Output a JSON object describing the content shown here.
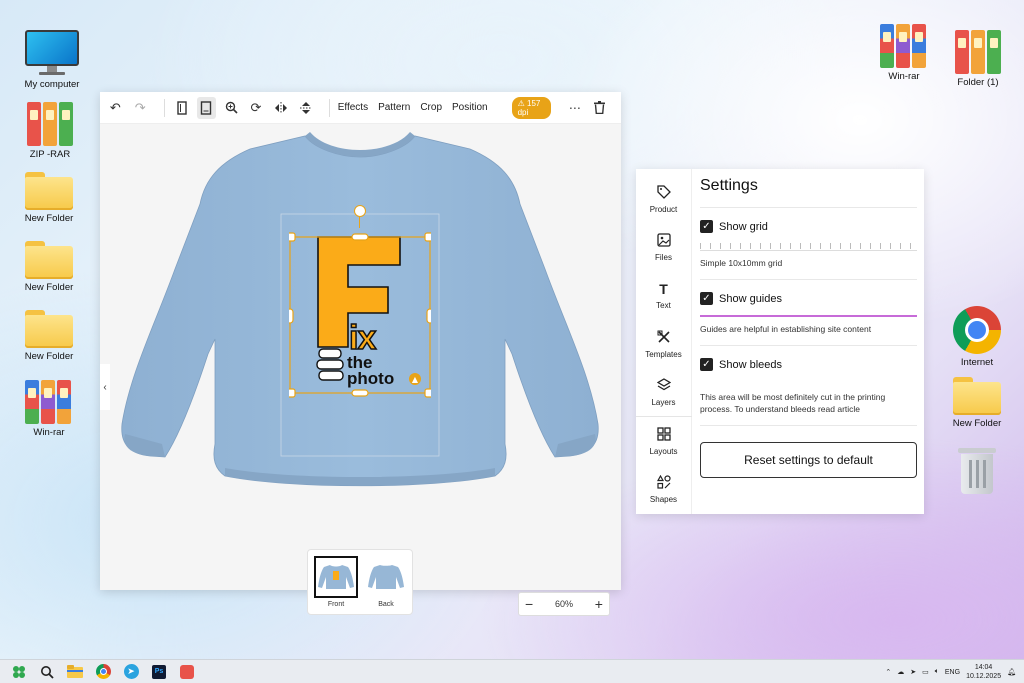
{
  "desktop": {
    "left_icons": [
      {
        "label": "My computer",
        "type": "monitor"
      },
      {
        "label": "ZIP -RAR",
        "type": "rar"
      },
      {
        "label": "New Folder",
        "type": "folder"
      },
      {
        "label": "New Folder",
        "type": "folder"
      },
      {
        "label": "New Folder",
        "type": "folder"
      },
      {
        "label": "Win-rar",
        "type": "winrar"
      }
    ],
    "right_icons": [
      {
        "label": "Win-rar",
        "type": "winrar"
      },
      {
        "label": "Folder (1)",
        "type": "rar"
      },
      {
        "label": "Internet",
        "type": "chrome"
      },
      {
        "label": "New Folder",
        "type": "folder"
      },
      {
        "label": "",
        "type": "trash"
      }
    ]
  },
  "editor": {
    "toolbar": {
      "undo_icon": "undo-icon",
      "redo_icon": "redo-icon",
      "effects": "Effects",
      "pattern": "Pattern",
      "crop": "Crop",
      "position": "Position",
      "dpi_badge": "157 dpi"
    },
    "design": {
      "text_big": "F",
      "text_ix": "ix",
      "text_the": "the",
      "text_photo": "photo"
    },
    "thumbnails": [
      {
        "label": "Front",
        "selected": true
      },
      {
        "label": "Back",
        "selected": false
      }
    ],
    "zoom": {
      "minus": "−",
      "value": "60%",
      "plus": "+"
    },
    "colors": {
      "shirt": "#97b7d6",
      "accent": "#fbab18",
      "handle": "#e8a317"
    }
  },
  "settings": {
    "title": "Settings",
    "rail": [
      {
        "label": "Product",
        "icon": "tag-icon"
      },
      {
        "label": "Files",
        "icon": "image-icon"
      },
      {
        "label": "Text",
        "icon": "text-icon"
      },
      {
        "label": "Templates",
        "icon": "templates-icon"
      },
      {
        "label": "Layers",
        "icon": "layers-icon"
      },
      {
        "label": "Layouts",
        "icon": "layouts-icon"
      },
      {
        "label": "Shapes",
        "icon": "shapes-icon"
      }
    ],
    "show_grid": {
      "label": "Show grid",
      "checked": true,
      "desc": "Simple 10x10mm grid"
    },
    "show_guides": {
      "label": "Show guides",
      "checked": true,
      "desc": "Guides are helpful in establishing site content"
    },
    "show_bleeds": {
      "label": "Show bleeds",
      "checked": true,
      "desc": "This area will be most definitely cut in the printing process. To understand bleeds read article"
    },
    "reset_label": "Reset settings to default"
  },
  "taskbar": {
    "lang": "ENG",
    "time": "14:04",
    "date": "10.12.2025"
  }
}
